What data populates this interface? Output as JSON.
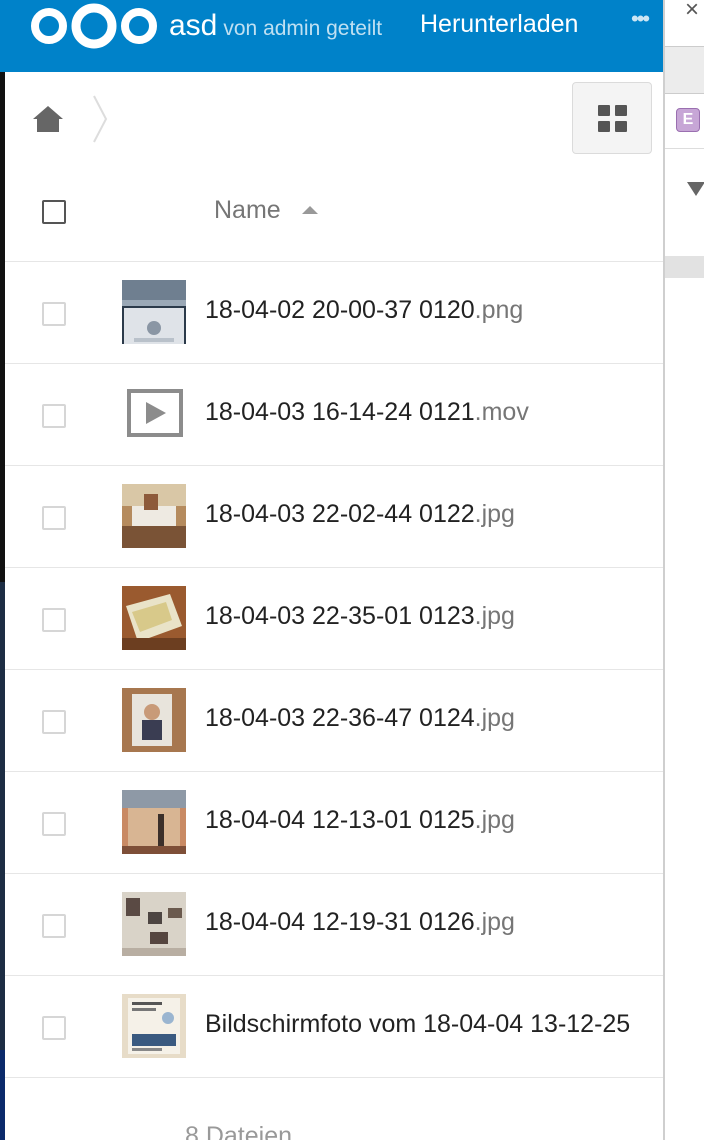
{
  "header": {
    "title": "asd",
    "owner_text": "von admin geteilt",
    "download_label": "Herunterladen",
    "more_label": "•••",
    "brand_color": "#0082c9"
  },
  "toolbar": {
    "home_icon": "home-icon",
    "view_toggle_icon": "grid-view-icon"
  },
  "list": {
    "column_name": "Name",
    "sort_direction": "ascending",
    "files": [
      {
        "base": "18-04-02 20-00-37 0120",
        "ext": ".png",
        "thumb": "screenshot"
      },
      {
        "base": "18-04-03 16-14-24 0121",
        "ext": ".mov",
        "thumb": "video"
      },
      {
        "base": "18-04-03 22-02-44 0122",
        "ext": ".jpg",
        "thumb": "photo-room"
      },
      {
        "base": "18-04-03 22-35-01 0123",
        "ext": ".jpg",
        "thumb": "photo-papers"
      },
      {
        "base": "18-04-03 22-36-47 0124",
        "ext": ".jpg",
        "thumb": "photo-portrait"
      },
      {
        "base": "18-04-04 12-13-01 0125",
        "ext": ".jpg",
        "thumb": "photo-wall"
      },
      {
        "base": "18-04-04 12-19-31 0126",
        "ext": ".jpg",
        "thumb": "photo-frames"
      },
      {
        "base": "Bildschirmfoto vom 18-04-04 13-12-25",
        "ext": "",
        "thumb": "screenshot-doc"
      }
    ],
    "summary": "8 Dateien"
  },
  "side_panel": {
    "close_label": "×",
    "badge_letter": "E"
  }
}
